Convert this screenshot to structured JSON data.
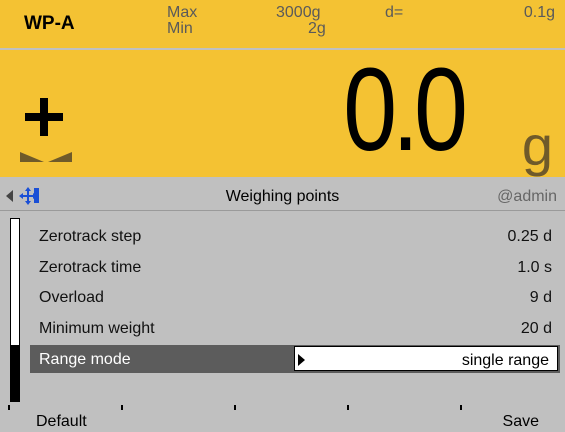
{
  "header": {
    "weighing_point": "WP-A",
    "max_label": "Max",
    "min_label": "Min",
    "max_value": "3000g",
    "min_value": "2g",
    "d_label": "d=",
    "d_value": "0.1g"
  },
  "display": {
    "sign": "+",
    "value": "0.0",
    "unit": "g"
  },
  "titlebar": {
    "title": "Weighing points",
    "user": "@admin"
  },
  "settings": [
    {
      "label": "Zerotrack step",
      "value": "0.25 d"
    },
    {
      "label": "Zerotrack time",
      "value": "1.0 s"
    },
    {
      "label": "Overload",
      "value": "9 d"
    },
    {
      "label": "Minimum weight",
      "value": "20 d"
    },
    {
      "label": "Range mode",
      "value": "single range"
    }
  ],
  "softkeys": {
    "left": "Default",
    "right": "Save"
  },
  "colors": {
    "display_background": "#f4c233",
    "selected_row": "#5c5c5c",
    "panel_background": "#c0c0c0"
  }
}
